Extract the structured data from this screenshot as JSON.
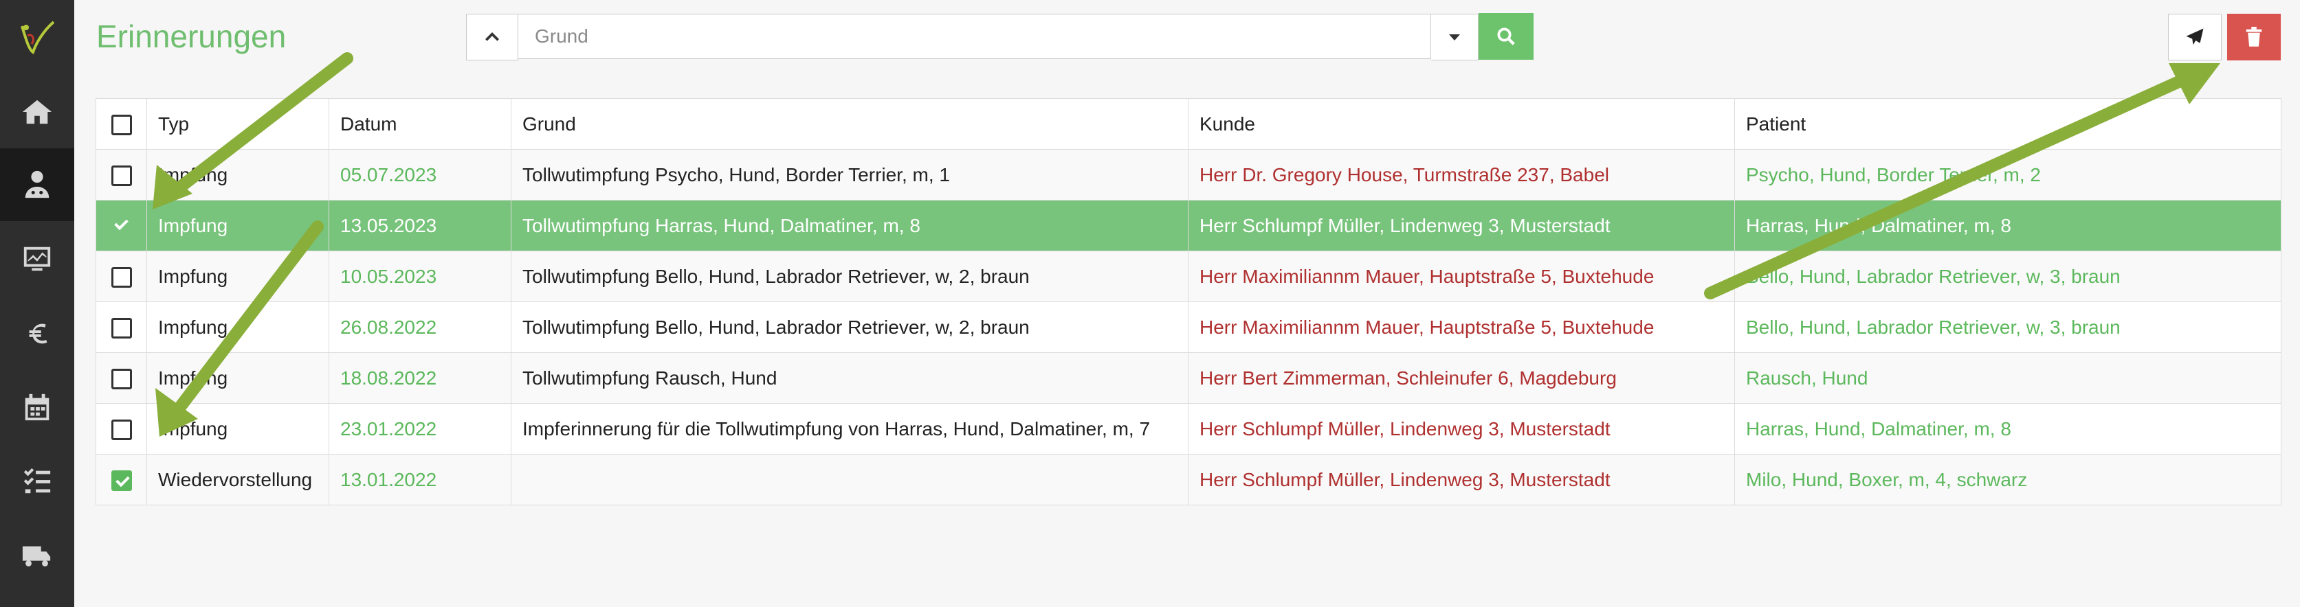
{
  "app": {
    "title": "Erinnerungen",
    "logo_icon": "vet-logo-icon",
    "accent_color": "#6fbe6f",
    "danger_color": "#d9534f"
  },
  "sidebar": {
    "items": [
      {
        "name": "home",
        "icon": "home-icon"
      },
      {
        "name": "doctor",
        "icon": "doctor-icon",
        "active": true
      },
      {
        "name": "monitor",
        "icon": "monitor-chart-icon"
      },
      {
        "name": "finance",
        "icon": "euro-icon"
      },
      {
        "name": "calendar",
        "icon": "calendar-icon"
      },
      {
        "name": "tasks",
        "icon": "checklist-icon"
      },
      {
        "name": "delivery",
        "icon": "truck-icon"
      }
    ]
  },
  "search": {
    "placeholder": "Grund",
    "value": ""
  },
  "table": {
    "headers": {
      "typ": "Typ",
      "datum": "Datum",
      "grund": "Grund",
      "kunde": "Kunde",
      "patient": "Patient"
    },
    "rows": [
      {
        "checked": false,
        "selected": false,
        "typ": "Impfung",
        "datum": "05.07.2023",
        "grund": "Tollwutimpfung Psycho, Hund, Border Terrier, m, 1",
        "kunde": "Herr Dr. Gregory House, Turmstraße 237, Babel",
        "patient": "Psycho, Hund, Border Terrier, m, 2"
      },
      {
        "checked": true,
        "selected": true,
        "typ": "Impfung",
        "datum": "13.05.2023",
        "grund": "Tollwutimpfung Harras, Hund, Dalmatiner, m, 8",
        "kunde": "Herr Schlumpf Müller, Lindenweg 3, Musterstadt",
        "patient": "Harras, Hund, Dalmatiner, m, 8"
      },
      {
        "checked": false,
        "selected": false,
        "typ": "Impfung",
        "datum": "10.05.2023",
        "grund": "Tollwutimpfung Bello, Hund, Labrador Retriever, w, 2, braun",
        "kunde": "Herr Maximiliannm Mauer, Hauptstraße 5, Buxtehude",
        "patient": "Bello, Hund, Labrador Retriever, w, 3, braun"
      },
      {
        "checked": false,
        "selected": false,
        "typ": "Impfung",
        "datum": "26.08.2022",
        "grund": "Tollwutimpfung Bello, Hund, Labrador Retriever, w, 2, braun",
        "kunde": "Herr Maximiliannm Mauer, Hauptstraße 5, Buxtehude",
        "patient": "Bello, Hund, Labrador Retriever, w, 3, braun"
      },
      {
        "checked": false,
        "selected": false,
        "typ": "Impfung",
        "datum": "18.08.2022",
        "grund": "Tollwutimpfung Rausch, Hund",
        "kunde": "Herr Bert Zimmerman, Schleinufer 6, Magdeburg",
        "patient": "Rausch, Hund"
      },
      {
        "checked": false,
        "selected": false,
        "typ": "Impfung",
        "datum": "23.01.2022",
        "grund": "Impferinnerung für die Tollwutimpfung von Harras, Hund, Dalmatiner, m, 7",
        "kunde": "Herr Schlumpf Müller, Lindenweg 3, Musterstadt",
        "patient": "Harras, Hund, Dalmatiner, m, 8"
      },
      {
        "checked": true,
        "selected": false,
        "typ": "Wiedervorstellung",
        "datum": "13.01.2022",
        "grund": "",
        "kunde": "Herr Schlumpf Müller, Lindenweg 3, Musterstadt",
        "patient": "Milo, Hund, Boxer, m, 4, schwarz"
      }
    ]
  },
  "annotations": {
    "arrow_color": "#8aae3a"
  }
}
